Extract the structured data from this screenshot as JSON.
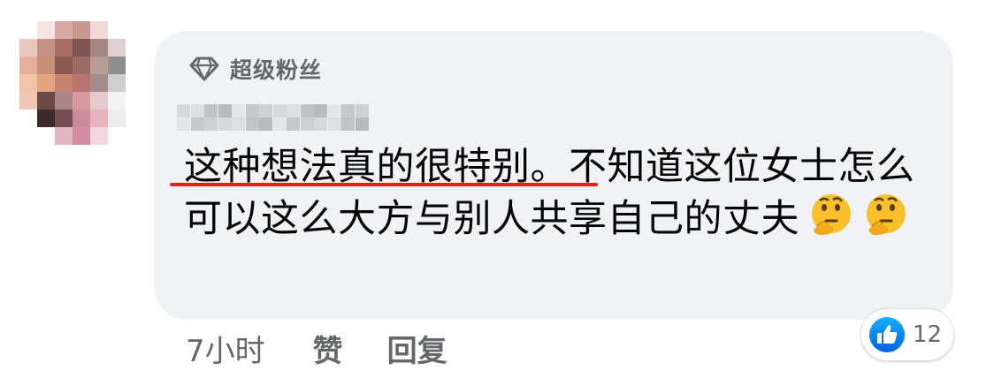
{
  "badge": {
    "icon": "diamond-icon",
    "label": "超级粉丝"
  },
  "comment": {
    "text_underlined": "这种想法真的很特别。",
    "text_rest": "不知道这位女士怎么可以这么大方与别人共享自己的丈夫",
    "emojis": [
      "thinking-face-icon",
      "thinking-face-icon"
    ]
  },
  "footer": {
    "time": "7小时",
    "like": "赞",
    "reply": "回复"
  },
  "reactions": {
    "icon": "like-icon",
    "count": "12"
  },
  "colors": {
    "bubble": "#f0f2f5",
    "secondary_text": "#65676b",
    "underline": "#e02020",
    "like_blue": "#1877f2"
  }
}
